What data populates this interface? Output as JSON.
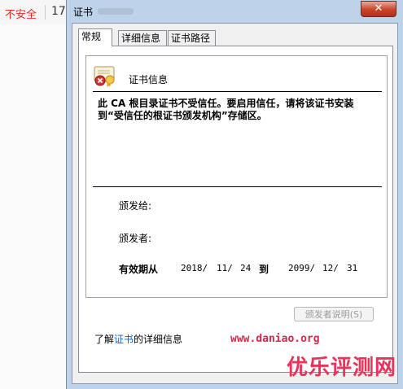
{
  "background": {
    "insecure_label": "不安全",
    "url_fragment": "17"
  },
  "dialog": {
    "title": "证书",
    "close_glyph": "✕",
    "tabs": [
      {
        "label": "常规"
      },
      {
        "label": "详细信息"
      },
      {
        "label": "证书路径"
      }
    ],
    "cert_heading": "证书信息",
    "warning": "此 CA 根目录证书不受信任。要启用信任，请将该证书安装到“受信任的根证书颁发机构”存储区。",
    "issued_to_label": "颁发给:",
    "issued_by_label": "颁发者:",
    "validity": {
      "label": "有效期从",
      "from": [
        "2018/",
        "11/",
        "24"
      ],
      "to_label": "到",
      "to": [
        "2099/",
        "12/",
        "31"
      ]
    },
    "issuer_statement_button": "颁发者说明(S)",
    "learn_more": {
      "prefix": "了解",
      "link": "证书",
      "suffix": "的详细信息"
    }
  },
  "watermark": {
    "url": "www.daniao.org",
    "logo": "优乐评测网"
  },
  "colors": {
    "insecure_red": "#d93025",
    "dialog_frame": "#bcd3ea",
    "link_blue": "#0066cc",
    "watermark_red": "#e8335a"
  }
}
